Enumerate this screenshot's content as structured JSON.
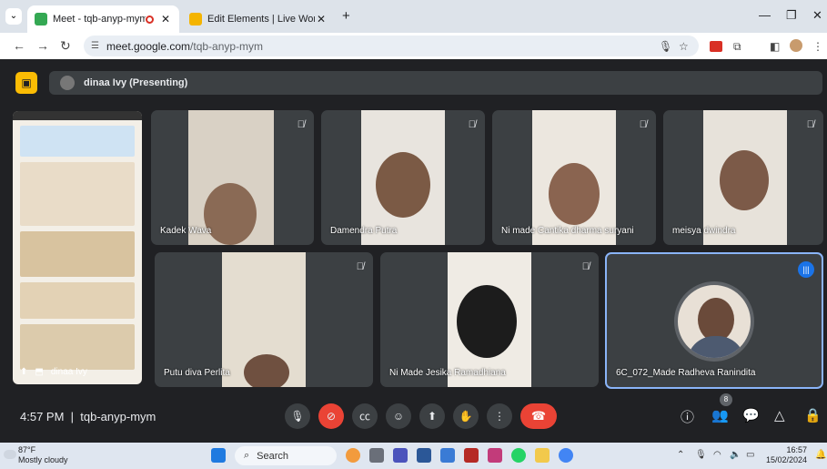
{
  "browser": {
    "tabs": [
      {
        "title": "Meet - tqb-anyp-mym",
        "active": true
      },
      {
        "title": "Edit Elements | Live Worksheets",
        "active": false
      }
    ],
    "url_host": "meet.google.com",
    "url_path": "/tqb-anyp-mym"
  },
  "meet": {
    "presenting_label": "dinaa Ivy (Presenting)",
    "presenter_name": "dinaa Ivy",
    "participants": [
      {
        "name": "Kadek Wava",
        "muted": true
      },
      {
        "name": "Damendra Putra",
        "muted": true
      },
      {
        "name": "Ni made Cantika dharma suryani",
        "muted": true
      },
      {
        "name": "meisya dwindra",
        "muted": true
      },
      {
        "name": "Putu diva Perlita",
        "muted": true
      },
      {
        "name": "Ni Made Jesika Ramadhiana",
        "muted": true
      },
      {
        "name": "6C_072_Made Radheva Ranindita",
        "muted": false,
        "speaking": true
      }
    ],
    "time": "4:57 PM",
    "separator": "|",
    "meeting_code": "tqb-anyp-mym",
    "people_count": "8",
    "colors": {
      "end_call": "#ea4335",
      "present_icon": "#fbbc04",
      "speaking": "#1a73e8"
    }
  },
  "taskbar": {
    "weather_temp": "87°F",
    "weather_desc": "Mostly cloudy",
    "search_label": "Search",
    "clock_time": "16:57",
    "clock_date": "15/02/2024"
  }
}
